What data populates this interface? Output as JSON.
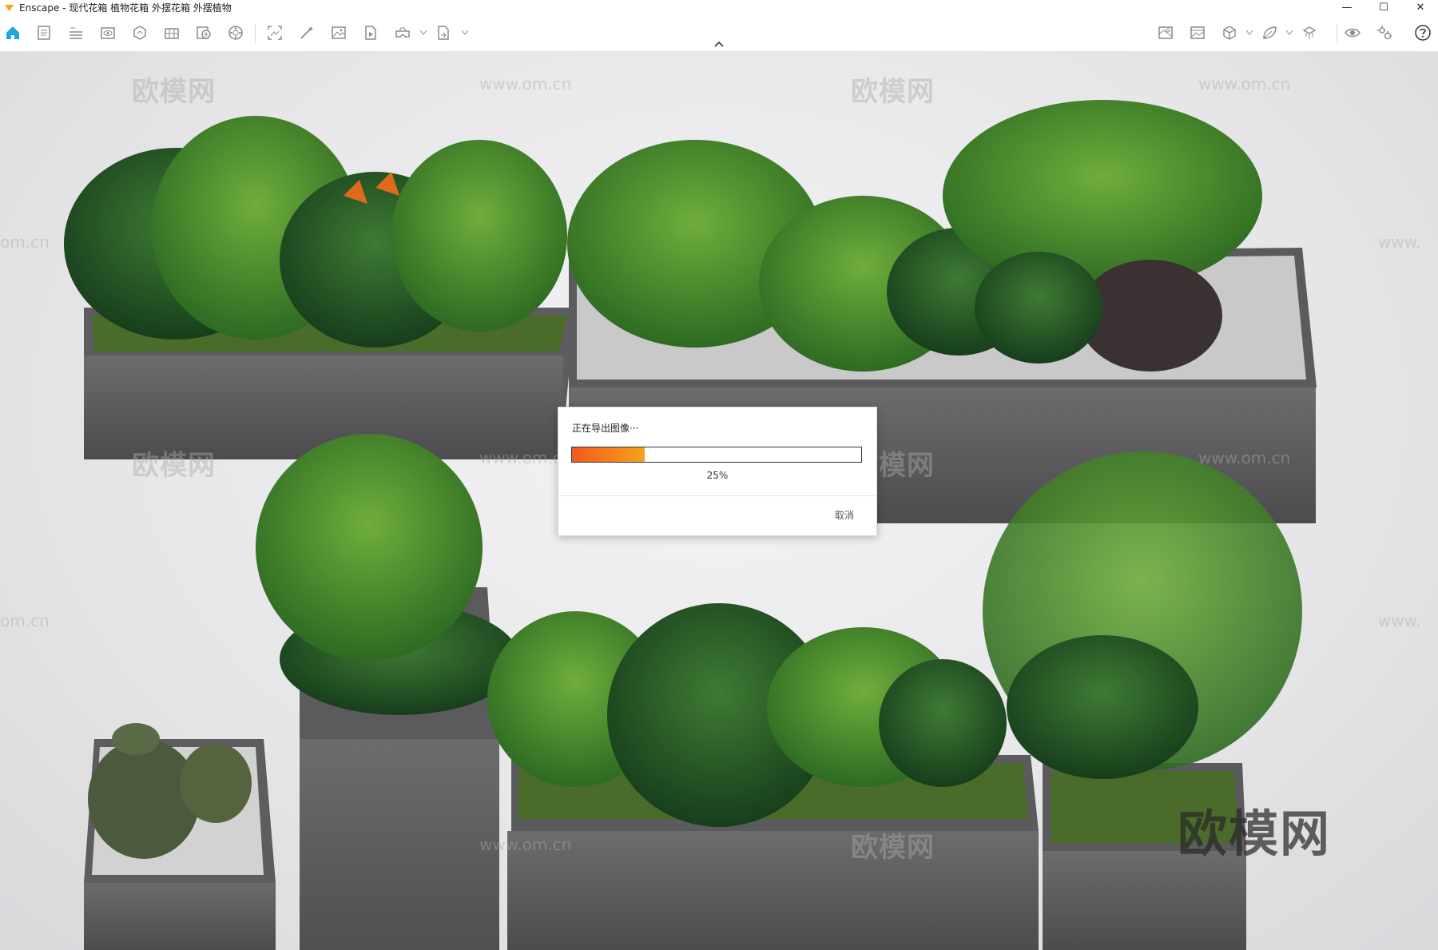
{
  "window": {
    "title": "Enscape - 现代花箱 植物花箱 外摆花箱 外摆植物",
    "controls": {
      "minimize": "—",
      "maximize": "☐",
      "close": "✕"
    }
  },
  "toolbar": {
    "left_icons": [
      "home-icon",
      "document-icon",
      "bim-icon",
      "visual-settings-icon",
      "asset-library-icon",
      "material-editor-icon",
      "capture-icon",
      "panorama-icon",
      "screenshot-icon",
      "video-editor-icon",
      "image-export-icon",
      "batch-export-icon",
      "vr-headset-icon",
      "export-icon"
    ],
    "right_icons": [
      "map-icon",
      "image-icon",
      "cube-icon",
      "leaf-icon",
      "orthographic-icon",
      "eye-icon",
      "settings-icon",
      "help-icon"
    ],
    "colors": {
      "accent": "#1fa8e0",
      "icon": "#8a8a8a"
    }
  },
  "watermarks": {
    "brand": "欧模网",
    "url": "www.om.cn",
    "url_partial_left": "om.cn",
    "url_partial_right": "www."
  },
  "dialog": {
    "title": "正在导出图像···",
    "progress": 0.25,
    "percent_label": "25%",
    "cancel_label": "取消",
    "fill_colors": {
      "start": "#f25a1e",
      "end": "#f7a21b"
    }
  }
}
